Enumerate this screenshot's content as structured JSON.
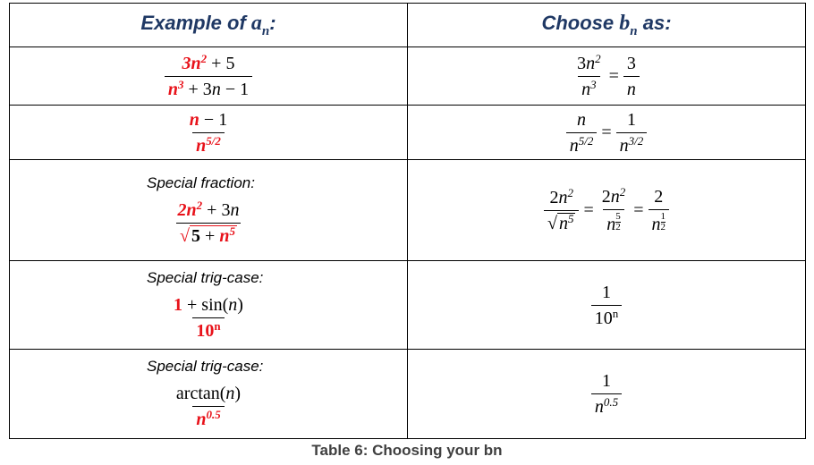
{
  "header": {
    "example_label": "Example of ",
    "example_var": "a",
    "example_sub": "n",
    "example_colon": ":",
    "choose_label": "Choose ",
    "choose_var": "b",
    "choose_sub": "n",
    "choose_suffix": " as:"
  },
  "rows": [
    {
      "label": null,
      "example": {
        "num": [
          {
            "t": "3n",
            "st": "rb",
            "sup": "2"
          },
          {
            "t": " + 5",
            "st": "n"
          }
        ],
        "den": [
          {
            "t": "n",
            "st": "rb",
            "sup": "3"
          },
          {
            "t": " + 3",
            "st": "n"
          },
          {
            "t": "n",
            "st": "i"
          },
          {
            "t": " − 1",
            "st": "n"
          }
        ]
      },
      "choose": [
        {
          "num": [
            {
              "t": "3",
              "st": "n"
            },
            {
              "t": "n",
              "st": "i",
              "sup": "2"
            }
          ],
          "den": [
            {
              "t": "n",
              "st": "i",
              "sup": "3"
            }
          ]
        },
        {
          "op": "="
        },
        {
          "num": [
            {
              "t": "3",
              "st": "n"
            }
          ],
          "den": [
            {
              "t": "n",
              "st": "i"
            }
          ]
        }
      ]
    },
    {
      "label": null,
      "example": {
        "num": [
          {
            "t": "n",
            "st": "rb"
          },
          {
            "t": " − 1",
            "st": "n"
          }
        ],
        "den": [
          {
            "t": "n",
            "st": "rb",
            "sup": "5/2"
          }
        ]
      },
      "choose": [
        {
          "num": [
            {
              "t": "n",
              "st": "i"
            }
          ],
          "den": [
            {
              "t": "n",
              "st": "i",
              "sup": "5/2"
            }
          ]
        },
        {
          "op": "="
        },
        {
          "num": [
            {
              "t": "1",
              "st": "n"
            }
          ],
          "den": [
            {
              "t": "n",
              "st": "i",
              "sup": "3/2"
            }
          ]
        }
      ]
    },
    {
      "label": "Special fraction:",
      "example": {
        "num": [
          {
            "t": "2n",
            "st": "rb",
            "sup": "2"
          },
          {
            "t": " + 3",
            "st": "n"
          },
          {
            "t": "n",
            "st": "i"
          }
        ],
        "den_sqrt": [
          {
            "t": "5",
            "st": "bn"
          },
          {
            "t": " + ",
            "st": "n"
          },
          {
            "t": "n",
            "st": "rb",
            "sup": "5"
          }
        ]
      },
      "choose": [
        {
          "num": [
            {
              "t": "2",
              "st": "n"
            },
            {
              "t": "n",
              "st": "i",
              "sup": "2"
            }
          ],
          "den_sqrt_plain": [
            {
              "t": "n",
              "st": "i",
              "sup": "5"
            }
          ]
        },
        {
          "op": "="
        },
        {
          "num": [
            {
              "t": "2",
              "st": "n"
            },
            {
              "t": "n",
              "st": "i",
              "sup": "2"
            }
          ],
          "den": [
            {
              "t": "n",
              "st": "i",
              "supf": [
                "5",
                "2"
              ]
            }
          ]
        },
        {
          "op": "="
        },
        {
          "num": [
            {
              "t": "2",
              "st": "n"
            }
          ],
          "den": [
            {
              "t": "n",
              "st": "i",
              "supf": [
                "1",
                "2"
              ]
            }
          ]
        }
      ]
    },
    {
      "label": "Special trig-case:",
      "example": {
        "num": [
          {
            "t": "1",
            "st": "rbn"
          },
          {
            "t": " + sin(",
            "st": "n"
          },
          {
            "t": "n",
            "st": "i"
          },
          {
            "t": ")",
            "st": "n"
          }
        ],
        "den": [
          {
            "t": "10",
            "st": "rbn",
            "sup": "n"
          }
        ]
      },
      "choose": [
        {
          "num": [
            {
              "t": "1",
              "st": "n"
            }
          ],
          "den": [
            {
              "t": "10",
              "st": "n",
              "sup": "n"
            }
          ]
        }
      ]
    },
    {
      "label": "Special trig-case:",
      "example": {
        "num": [
          {
            "t": "arctan(",
            "st": "n"
          },
          {
            "t": "n",
            "st": "i"
          },
          {
            "t": ")",
            "st": "n"
          }
        ],
        "den": [
          {
            "t": "n",
            "st": "rb",
            "sup": "0.5"
          }
        ]
      },
      "choose": [
        {
          "num": [
            {
              "t": "1",
              "st": "n"
            }
          ],
          "den": [
            {
              "t": "n",
              "st": "i",
              "sup": "0.5"
            }
          ]
        }
      ]
    }
  ],
  "caption": "Table 6: Choosing your bn",
  "colors": {
    "highlight": "#e8121a",
    "header": "#1f3864"
  }
}
